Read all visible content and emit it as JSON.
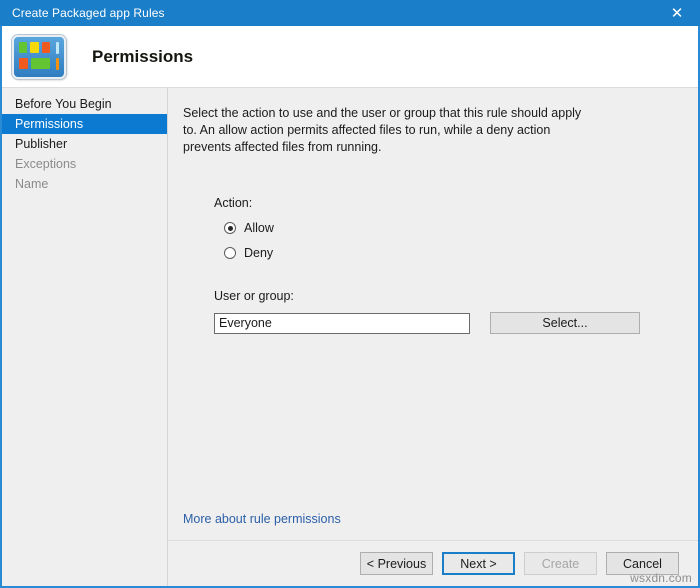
{
  "window": {
    "title": "Create Packaged app Rules",
    "close_icon": "close-icon",
    "accent_color": "#1b7ec8"
  },
  "header": {
    "icon_name": "packaged-app-tiles-icon",
    "page_title": "Permissions"
  },
  "nav": {
    "items": [
      {
        "label": "Before You Begin",
        "state": "normal"
      },
      {
        "label": "Permissions",
        "state": "selected"
      },
      {
        "label": "Publisher",
        "state": "normal"
      },
      {
        "label": "Exceptions",
        "state": "disabled"
      },
      {
        "label": "Name",
        "state": "disabled"
      }
    ],
    "selected_color": "#0b7ad0"
  },
  "main": {
    "description": "Select the action to use and the user or group that this rule should apply to. An allow action permits affected files to run, while a deny action prevents affected files from running.",
    "action": {
      "label": "Action:",
      "options": [
        {
          "label": "Allow",
          "checked": true
        },
        {
          "label": "Deny",
          "checked": false
        }
      ]
    },
    "user_or_group": {
      "label": "User or group:",
      "value": "Everyone",
      "placeholder": "",
      "select_button": "Select..."
    },
    "more_link": "More about rule permissions"
  },
  "footer": {
    "buttons": [
      {
        "label": "< Previous",
        "state": "normal"
      },
      {
        "label": "Next >",
        "state": "focused"
      },
      {
        "label": "Create",
        "state": "disabled"
      },
      {
        "label": "Cancel",
        "state": "normal"
      }
    ]
  },
  "watermark": "wsxdn.com"
}
